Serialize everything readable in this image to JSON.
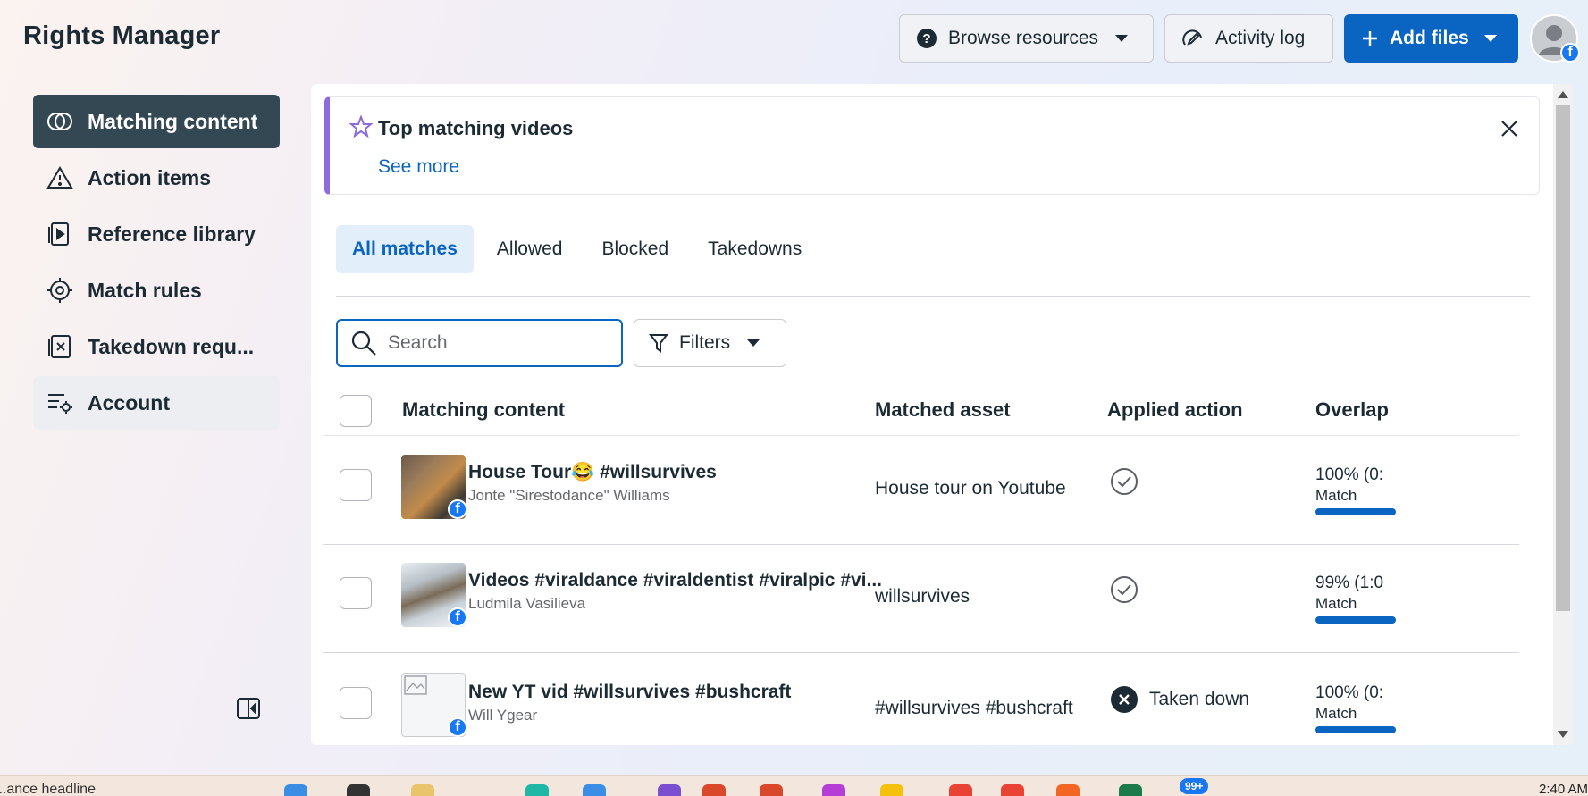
{
  "app": {
    "title": "Rights Manager"
  },
  "header": {
    "browse_label": "Browse resources",
    "activity_label": "Activity log",
    "add_files_label": "Add files"
  },
  "sidebar": {
    "items": [
      {
        "label": "Matching content",
        "icon": "overlap-circles-icon",
        "active": true
      },
      {
        "label": "Action items",
        "icon": "warning-triangle-icon"
      },
      {
        "label": "Reference library",
        "icon": "video-file-icon"
      },
      {
        "label": "Match rules",
        "icon": "crosshair-icon"
      },
      {
        "label": "Takedown requ...",
        "icon": "takedown-icon"
      },
      {
        "label": "Account",
        "icon": "settings-list-icon"
      }
    ]
  },
  "banner": {
    "title": "Top matching videos",
    "link": "See more"
  },
  "tabs": [
    {
      "label": "All matches",
      "active": true
    },
    {
      "label": "Allowed"
    },
    {
      "label": "Blocked"
    },
    {
      "label": "Takedowns"
    }
  ],
  "search": {
    "placeholder": "Search",
    "value": ""
  },
  "filters": {
    "label": "Filters"
  },
  "table": {
    "columns": [
      "Matching content",
      "Matched asset",
      "Applied action",
      "Overlap"
    ],
    "rows": [
      {
        "title": "House Tour😂 #willsurvives",
        "author": "Jonte \"Sirestodance\" Williams",
        "asset": "House tour on Youtube",
        "action": "",
        "action_icon": "check-circle-icon",
        "overlap_pct": "100% (0:",
        "overlap_label": "Match"
      },
      {
        "title": "Videos #viraldance #viraldentist #viralpic #vi...",
        "author": "Ludmila Vasilieva",
        "asset": "willsurvives",
        "action": "",
        "action_icon": "check-circle-icon",
        "overlap_pct": "99% (1:0",
        "overlap_label": "Match"
      },
      {
        "title": "New YT vid #willsurvives #bushcraft",
        "author": "Will Ygear",
        "asset": "#willsurvives #bushcraft",
        "action": "Taken down",
        "action_icon": "x-circle-icon",
        "overlap_pct": "100% (0:",
        "overlap_label": "Match"
      }
    ]
  },
  "taskbar": {
    "news": "...ance headline",
    "badge": "99+",
    "clock": "2:40 AM"
  },
  "colors": {
    "primary": "#0a65c2",
    "sidebar_active": "#344854",
    "banner_accent": "#8d6bdc",
    "facebook": "#1877f2"
  }
}
